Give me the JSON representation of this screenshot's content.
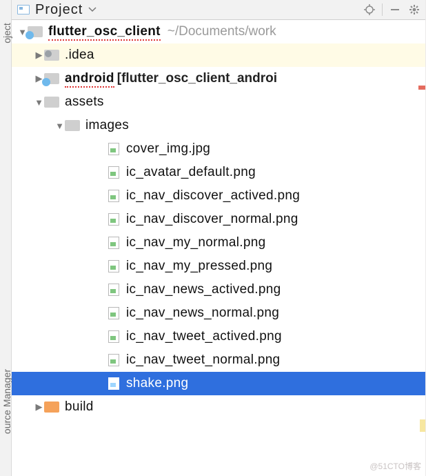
{
  "toolbar": {
    "label": "Project"
  },
  "sidebar": {
    "top_label": "oject",
    "bottom_label": "ource Manager"
  },
  "tree": {
    "root": {
      "name": "flutter_osc_client",
      "path": "~/Documents/work"
    },
    "idea": ".idea",
    "android": {
      "name": "android",
      "suffix": "[flutter_osc_client_androi"
    },
    "assets": "assets",
    "images": "images",
    "files": [
      "cover_img.jpg",
      "ic_avatar_default.png",
      "ic_nav_discover_actived.png",
      "ic_nav_discover_normal.png",
      "ic_nav_my_normal.png",
      "ic_nav_my_pressed.png",
      "ic_nav_news_actived.png",
      "ic_nav_news_normal.png",
      "ic_nav_tweet_actived.png",
      "ic_nav_tweet_normal.png",
      "shake.png"
    ],
    "build": "build"
  },
  "watermark": "@51CTO博客"
}
